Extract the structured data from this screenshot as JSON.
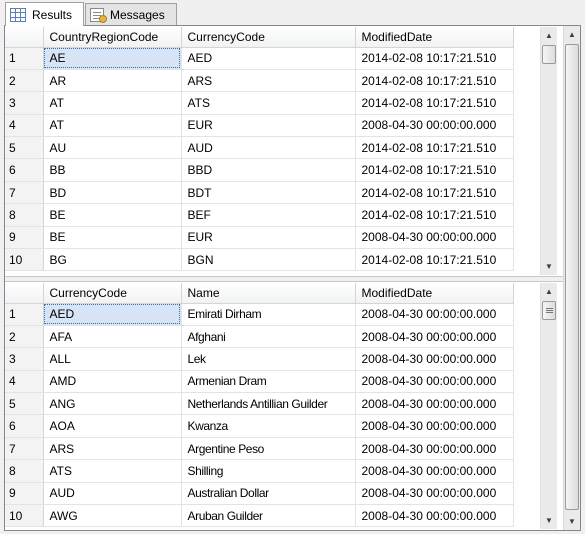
{
  "tabs": [
    {
      "label": "Results",
      "icon": "grid-icon",
      "active": true
    },
    {
      "label": "Messages",
      "icon": "messages-icon",
      "active": false
    }
  ],
  "grid1": {
    "columns": [
      "CountryRegionCode",
      "CurrencyCode",
      "ModifiedDate"
    ],
    "rows": [
      {
        "n": "1",
        "cells": [
          "AE",
          "AED",
          "2014-02-08 10:17:21.510"
        ]
      },
      {
        "n": "2",
        "cells": [
          "AR",
          "ARS",
          "2014-02-08 10:17:21.510"
        ]
      },
      {
        "n": "3",
        "cells": [
          "AT",
          "ATS",
          "2014-02-08 10:17:21.510"
        ]
      },
      {
        "n": "4",
        "cells": [
          "AT",
          "EUR",
          "2008-04-30 00:00:00.000"
        ]
      },
      {
        "n": "5",
        "cells": [
          "AU",
          "AUD",
          "2014-02-08 10:17:21.510"
        ]
      },
      {
        "n": "6",
        "cells": [
          "BB",
          "BBD",
          "2014-02-08 10:17:21.510"
        ]
      },
      {
        "n": "7",
        "cells": [
          "BD",
          "BDT",
          "2014-02-08 10:17:21.510"
        ]
      },
      {
        "n": "8",
        "cells": [
          "BE",
          "BEF",
          "2014-02-08 10:17:21.510"
        ]
      },
      {
        "n": "9",
        "cells": [
          "BE",
          "EUR",
          "2008-04-30 00:00:00.000"
        ]
      },
      {
        "n": "10",
        "cells": [
          "BG",
          "BGN",
          "2014-02-08 10:17:21.510"
        ]
      }
    ]
  },
  "grid2": {
    "columns": [
      "CurrencyCode",
      "Name",
      "ModifiedDate"
    ],
    "rows": [
      {
        "n": "1",
        "cells": [
          "AED",
          "Emirati Dirham",
          "2008-04-30 00:00:00.000"
        ]
      },
      {
        "n": "2",
        "cells": [
          "AFA",
          "Afghani",
          "2008-04-30 00:00:00.000"
        ]
      },
      {
        "n": "3",
        "cells": [
          "ALL",
          "Lek",
          "2008-04-30 00:00:00.000"
        ]
      },
      {
        "n": "4",
        "cells": [
          "AMD",
          "Armenian Dram",
          "2008-04-30 00:00:00.000"
        ]
      },
      {
        "n": "5",
        "cells": [
          "ANG",
          "Netherlands Antillian Guilder",
          "2008-04-30 00:00:00.000"
        ]
      },
      {
        "n": "6",
        "cells": [
          "AOA",
          "Kwanza",
          "2008-04-30 00:00:00.000"
        ]
      },
      {
        "n": "7",
        "cells": [
          "ARS",
          "Argentine Peso",
          "2008-04-30 00:00:00.000"
        ]
      },
      {
        "n": "8",
        "cells": [
          "ATS",
          "Shilling",
          "2008-04-30 00:00:00.000"
        ]
      },
      {
        "n": "9",
        "cells": [
          "AUD",
          "Australian Dollar",
          "2008-04-30 00:00:00.000"
        ]
      },
      {
        "n": "10",
        "cells": [
          "AWG",
          "Aruban Guilder",
          "2008-04-30 00:00:00.000"
        ]
      }
    ]
  },
  "colors": {
    "selected_cell": "#d7e4f5",
    "grid_line": "#e3e3e3",
    "header_bg": "#f1f2f4"
  }
}
